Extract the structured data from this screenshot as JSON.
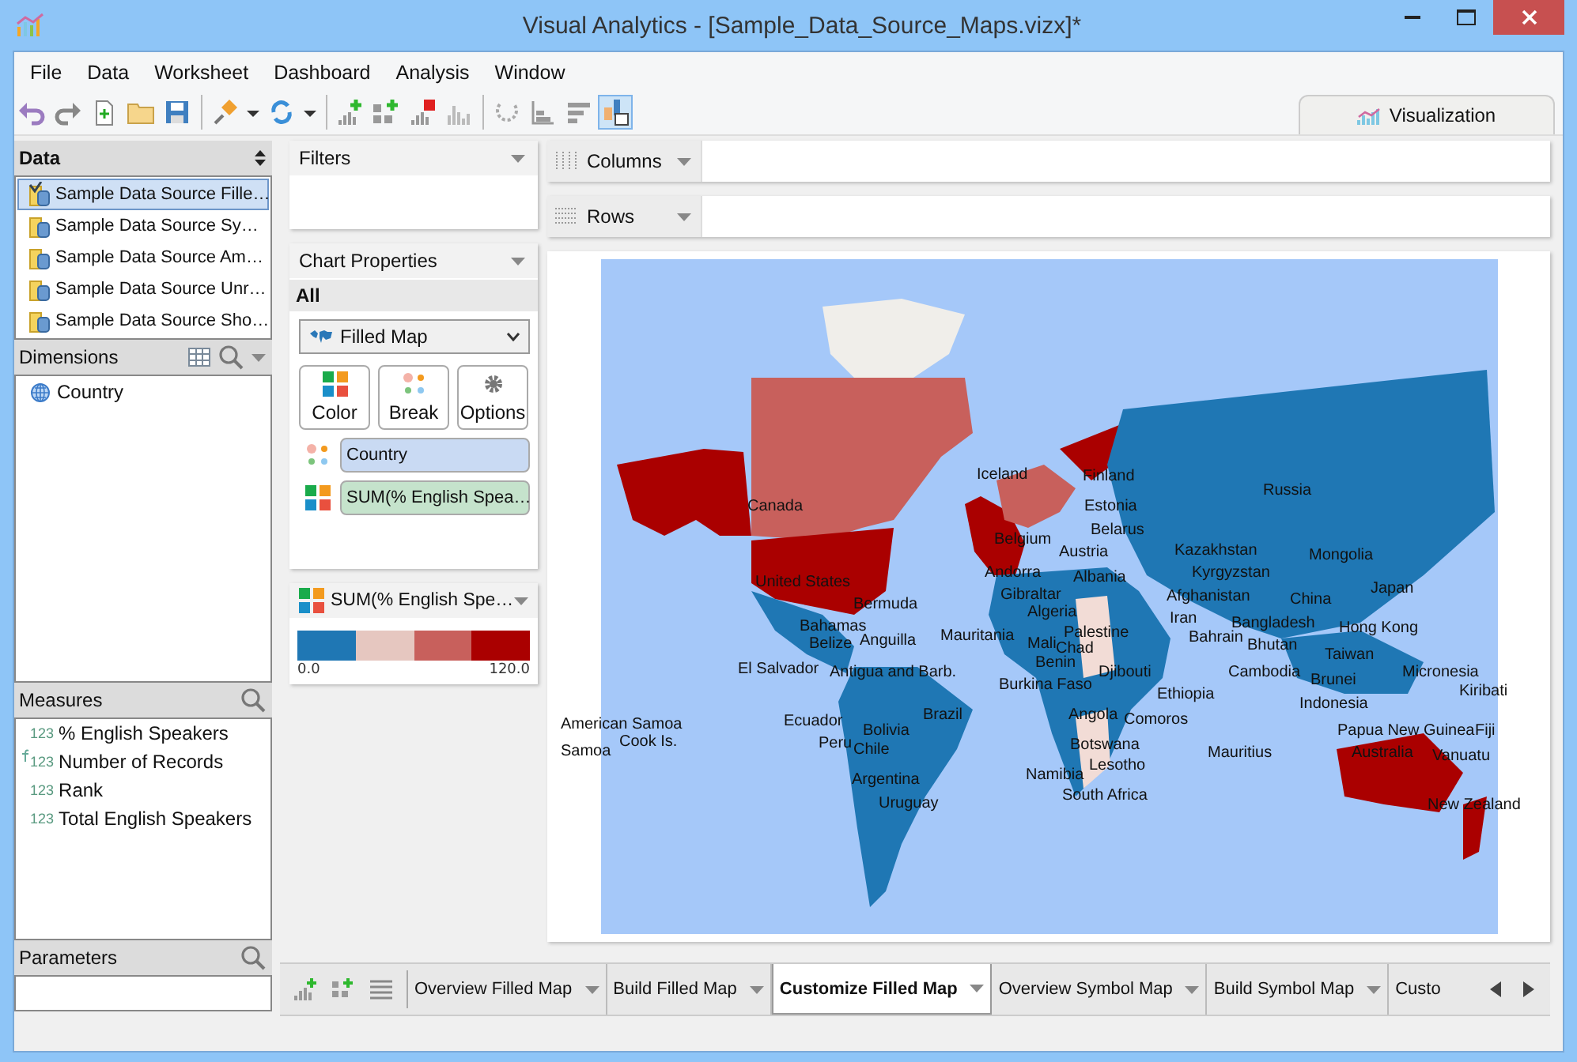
{
  "window": {
    "title": "Visual Analytics - [Sample_Data_Source_Maps.vizx]*"
  },
  "menu": [
    "File",
    "Data",
    "Worksheet",
    "Dashboard",
    "Analysis",
    "Window"
  ],
  "view_tab": {
    "label": "Visualization",
    "selected": true
  },
  "data_panel": {
    "title": "Data",
    "sources": [
      {
        "label": "Sample Data Source Fille…",
        "selected": true
      },
      {
        "label": "Sample Data Source Sy…",
        "selected": false
      },
      {
        "label": "Sample Data Source Am…",
        "selected": false
      },
      {
        "label": "Sample Data Source Unr…",
        "selected": false
      },
      {
        "label": "Sample Data Source Sho…",
        "selected": false
      }
    ]
  },
  "dimensions": {
    "title": "Dimensions",
    "items": [
      "Country"
    ]
  },
  "measures": {
    "title": "Measures",
    "items": [
      {
        "label": "% English Speakers",
        "type_label": "123",
        "kind": "field"
      },
      {
        "label": "Number of Records",
        "type_label": "123",
        "kind": "calculated"
      },
      {
        "label": "Rank",
        "type_label": "123",
        "kind": "field"
      },
      {
        "label": "Total English Speakers",
        "type_label": "123",
        "kind": "field"
      }
    ]
  },
  "parameters": {
    "title": "Parameters"
  },
  "filters": {
    "title": "Filters"
  },
  "chart_properties": {
    "title": "Chart Properties",
    "scope": "All",
    "chart_type": "Filled Map",
    "buttons": [
      {
        "label": "Color",
        "kind": "color"
      },
      {
        "label": "Break",
        "kind": "break"
      },
      {
        "label": "Options",
        "kind": "options"
      }
    ],
    "shelves": [
      {
        "label": "Country",
        "kind": "break"
      },
      {
        "label": "SUM(% English Spea…",
        "kind": "color"
      }
    ]
  },
  "legend": {
    "title": "SUM(% English Spe…",
    "segments": [
      {
        "color": "#1f77b4"
      },
      {
        "color": "#e6c7c0"
      },
      {
        "color": "#c8605c"
      },
      {
        "color": "#aa0000"
      }
    ],
    "min": "0.0",
    "max": "120.0"
  },
  "columns_shelf": {
    "label": "Columns"
  },
  "rows_shelf": {
    "label": "Rows"
  },
  "map": {
    "labels": [
      "Canada",
      "United States",
      "Bermuda",
      "Bahamas",
      "Belize",
      "Anguilla",
      "El Salvador",
      "Antigua and Barb.",
      "Ecuador",
      "Bolivia",
      "Brazil",
      "Peru",
      "Chile",
      "Argentina",
      "Uruguay",
      "American Samoa",
      "Cook Is.",
      "Samoa",
      "Iceland",
      "Finland",
      "Estonia",
      "Belarus",
      "Belgium",
      "Austria",
      "Andorra",
      "Albania",
      "Gibraltar",
      "Algeria",
      "Mauritania",
      "Mali",
      "Palestine",
      "Chad",
      "Bahrain",
      "Benin",
      "Burkina Faso",
      "Djibouti",
      "Ethiopia",
      "Angola",
      "Comoros",
      "Botswana",
      "Lesotho",
      "Namibia",
      "Mauritius",
      "South Africa",
      "Russia",
      "Kazakhstan",
      "Mongolia",
      "Kyrgyzstan",
      "Afghanistan",
      "Iran",
      "China",
      "Japan",
      "Bangladesh",
      "Hong Kong",
      "Bhutan",
      "Taiwan",
      "Cambodia",
      "Brunei",
      "Micronesia",
      "Kiribati",
      "Indonesia",
      "Papua New Guinea",
      "Fiji",
      "Australia",
      "Vanuatu",
      "New Zealand"
    ]
  },
  "sheet_tabs": [
    {
      "label": "Overview Filled Map",
      "selected": false
    },
    {
      "label": "Build Filled Map",
      "selected": false
    },
    {
      "label": "Customize Filled Map",
      "selected": true
    },
    {
      "label": "Overview Symbol Map",
      "selected": false
    },
    {
      "label": "Build Symbol Map",
      "selected": false
    },
    {
      "label": "Custo",
      "selected": false
    }
  ]
}
